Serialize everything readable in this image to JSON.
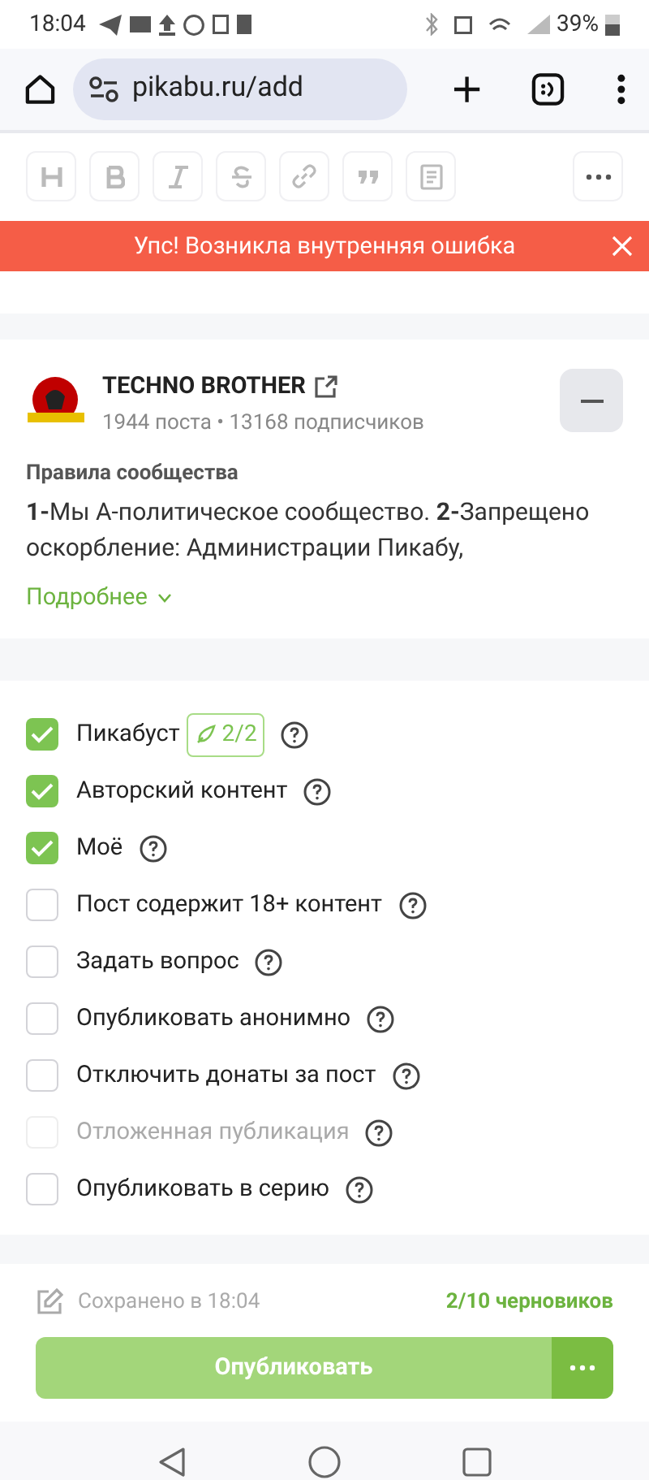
{
  "status_bar": {
    "time": "18:04",
    "battery": "39%"
  },
  "browser": {
    "url": "pikabu.ru/add"
  },
  "toast": {
    "message": "Упс! Возникла внутренняя ошибка"
  },
  "community": {
    "name": "TECHNO BROTHER",
    "stats": "1944 поста • 13168 подписчиков",
    "rules_title": "Правила сообщества",
    "rules_text": "**1-**Мы А-политическое сообщество. **2-**Запрещено оскорбление: Администрации Пикабу,",
    "more": "Подробнее"
  },
  "options": [
    {
      "label": "Пикабуст",
      "checked": true,
      "disabled": false,
      "badge": "2/2"
    },
    {
      "label": "Авторский контент",
      "checked": true,
      "disabled": false
    },
    {
      "label": "Моё",
      "checked": true,
      "disabled": false
    },
    {
      "label": "Пост содержит 18+ контент",
      "checked": false,
      "disabled": false
    },
    {
      "label": "Задать вопрос",
      "checked": false,
      "disabled": false
    },
    {
      "label": "Опубликовать анонимно",
      "checked": false,
      "disabled": false
    },
    {
      "label": "Отключить донаты за пост",
      "checked": false,
      "disabled": false
    },
    {
      "label": "Отложенная публикация",
      "checked": false,
      "disabled": true
    },
    {
      "label": "Опубликовать в серию",
      "checked": false,
      "disabled": false
    }
  ],
  "footer": {
    "saved": "Сохранено в 18:04",
    "drafts": "2/10 черновиков",
    "publish": "Опубликовать"
  }
}
